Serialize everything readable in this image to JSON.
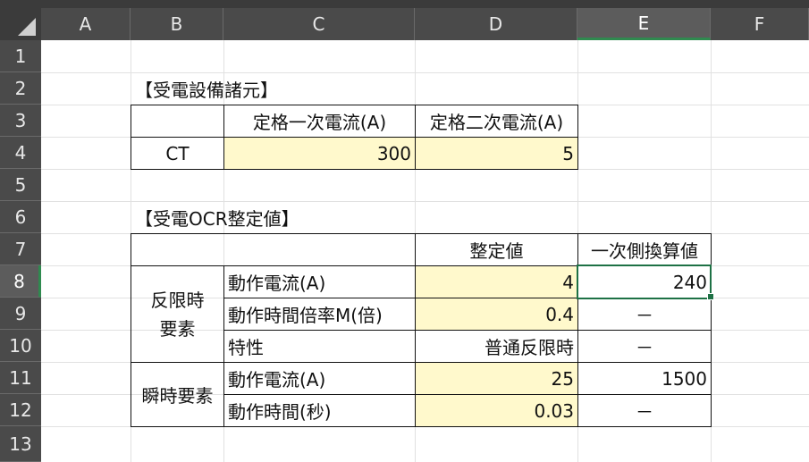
{
  "columns": [
    "A",
    "B",
    "C",
    "D",
    "E",
    "F"
  ],
  "rows": [
    "1",
    "2",
    "3",
    "4",
    "5",
    "6",
    "7",
    "8",
    "9",
    "10",
    "11",
    "12",
    "13"
  ],
  "selected_cell": "E8",
  "section1": {
    "title": "【受電設備諸元】",
    "header_primary": "定格一次電流(A)",
    "header_secondary": "定格二次電流(A)",
    "row_label": "CT",
    "primary_value": "300",
    "secondary_value": "5"
  },
  "section2": {
    "title": "【受電OCR整定値】",
    "header_setting": "整定値",
    "header_converted": "一次側換算値",
    "group_inverse_line1": "反限時",
    "group_inverse_line2": "要素",
    "group_instant": "瞬時要素",
    "rows": [
      {
        "label": "動作電流(A)",
        "setting": "4",
        "converted": "240"
      },
      {
        "label": "動作時間倍率M(倍)",
        "setting": "0.4",
        "converted": "－"
      },
      {
        "label": "特性",
        "setting": "普通反限時",
        "converted": "－"
      },
      {
        "label": "動作電流(A)",
        "setting": "25",
        "converted": "1500"
      },
      {
        "label": "動作時間(秒)",
        "setting": "0.03",
        "converted": "－"
      }
    ]
  }
}
